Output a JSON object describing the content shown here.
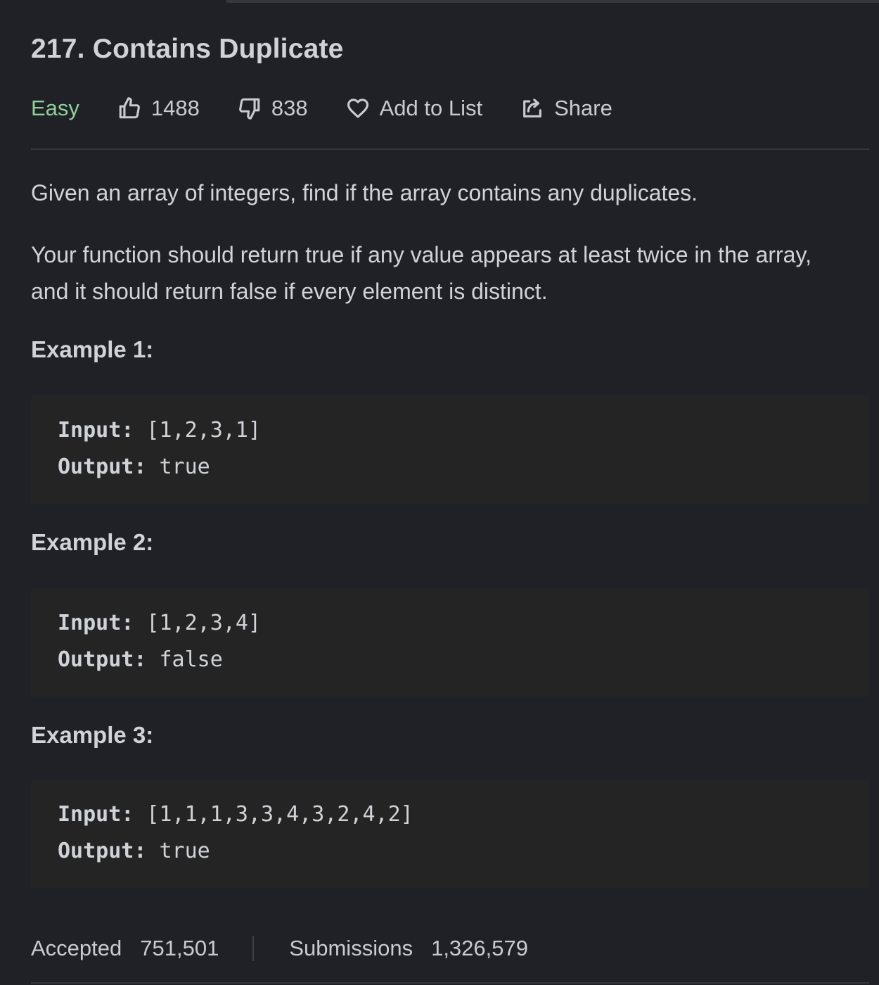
{
  "problem": {
    "title": "217. Contains Duplicate",
    "difficulty": "Easy",
    "likes": "1488",
    "dislikes": "838",
    "add_to_list_label": "Add to List",
    "share_label": "Share"
  },
  "description": {
    "paragraph_1": "Given an array of integers, find if the array contains any duplicates.",
    "paragraph_2": "Your function should return true if any value appears at least twice in the array, and it should return false if every element is distinct."
  },
  "examples": [
    {
      "title": "Example 1:",
      "input_label": "Input:",
      "input_value": " [1,2,3,1]",
      "output_label": "Output:",
      "output_value": " true"
    },
    {
      "title": "Example 2:",
      "input_label": "Input:",
      "input_value": " [1,2,3,4]",
      "output_label": "Output:",
      "output_value": " false"
    },
    {
      "title": "Example 3:",
      "input_label": "Input:",
      "input_value": " [1,1,1,3,3,4,3,2,4,2]",
      "output_label": "Output:",
      "output_value": " true"
    }
  ],
  "stats": {
    "accepted_label": "Accepted",
    "accepted_value": "751,501",
    "submissions_label": "Submissions",
    "submissions_value": "1,326,579"
  },
  "colors": {
    "background": "#1f2126",
    "difficulty_easy": "#8fcf9a",
    "code_background": "#242424"
  }
}
